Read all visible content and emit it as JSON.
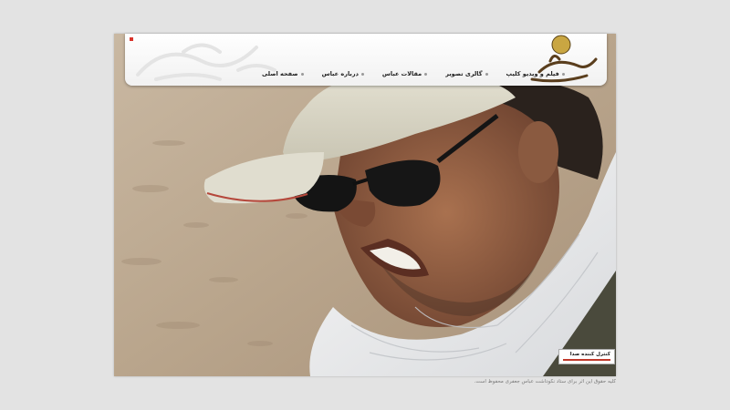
{
  "colors": {
    "page_background": "#e3e3e3",
    "header_background": "#ffffff",
    "accent_red": "#c0392b",
    "nav_text": "#222222",
    "footer_text": "#777777"
  },
  "header": {
    "nav": [
      {
        "label": "صفحه اصلی"
      },
      {
        "label": "درباره عباس"
      },
      {
        "label": "مقالات عباس"
      },
      {
        "label": "گالری تصویر"
      },
      {
        "label": "فیلم و ویدیو کلیپ"
      }
    ],
    "logo_icon": "calligraphy-logo-icon",
    "watermark_icon": "calligraphy-watermark-icon",
    "corner_icon": "red-square-icon"
  },
  "hero": {
    "photo_icon": "portrait-photo"
  },
  "sound_control": {
    "label": "کنترل کننده صدا"
  },
  "footer": {
    "copyright": "کلیه حقوق این اثر برای ستاد نکوداشت عباس جعفری محفوظ است."
  }
}
